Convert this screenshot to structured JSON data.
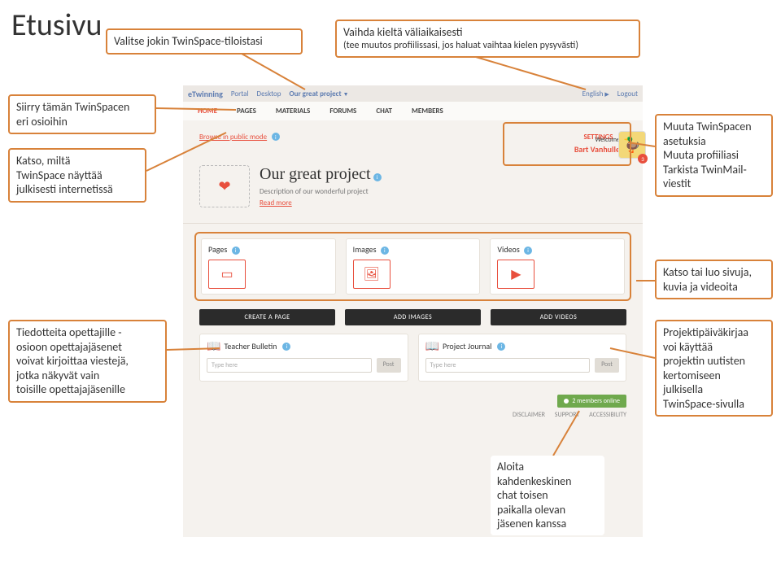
{
  "page_title": "Etusivu",
  "callouts": {
    "c1": "Valitse jokin TwinSpace-tiloistasi",
    "c2_l1": "Vaihda kieltä väliaikaisesti",
    "c2_l2": "(tee muutos profiilissasi, jos haluat vaihtaa kielen pysyvästi)",
    "c3_l1": "Siirry tämän TwinSpacen",
    "c3_l2": "eri osioihin",
    "c4_l1": "Katso, miltä",
    "c4_l2": "TwinSpace näyttää",
    "c4_l3": "julkisesti internetissä",
    "c5_l1": "Muuta TwinSpacen",
    "c5_l2": "asetuksia",
    "c5_l3": "Muuta profiiliasi",
    "c5_l4": "Tarkista TwinMail-",
    "c5_l5": "viestit",
    "c6_l1": "Katso tai luo sivuja,",
    "c6_l2": "kuvia ja videoita",
    "c7_l1": "Tiedotteita opettajille -",
    "c7_l2": "osioon opettajajäsenet",
    "c7_l3": "voivat kirjoittaa viestejä,",
    "c7_l4": "jotka näkyvät vain",
    "c7_l5": "toisille opettajajäsenille",
    "c8_l1": "Projektipäiväkirjaa",
    "c8_l2": "voi käyttää",
    "c8_l3": "projektin uutisten",
    "c8_l4": "kertomiseen",
    "c8_l5": "julkisella",
    "c8_l6": "TwinSpace-sivulla",
    "c9_l1": "Aloita",
    "c9_l2": "kahdenkeskinen",
    "c9_l3": "chat toisen",
    "c9_l4": "paikalla olevan",
    "c9_l5": "jäsenen kanssa"
  },
  "topbar": {
    "logo": "eTwinning",
    "portal": "Portal",
    "desktop": "Desktop",
    "project": "Our great project",
    "english": "English",
    "logout": "Logout"
  },
  "nav": {
    "home": "HOME",
    "pages": "PAGES",
    "materials": "MATERIALS",
    "forums": "FORUMS",
    "chat": "CHAT",
    "members": "MEMBERS"
  },
  "browse": "Browse in public mode",
  "settings": "SETTINGS",
  "welcome": {
    "label": "Welcome",
    "name": "Bart Vanhulle",
    "mail_badge": "3"
  },
  "project": {
    "title": "Our great project",
    "desc": "Description of our wonderful project",
    "readmore": "Read more"
  },
  "cards": {
    "pages": "Pages",
    "images": "Images",
    "videos": "Videos"
  },
  "buttons": {
    "create_page": "CREATE A PAGE",
    "add_images": "ADD IMAGES",
    "add_videos": "ADD VIDEOS"
  },
  "panels": {
    "bulletin": "Teacher Bulletin",
    "journal": "Project Journal",
    "placeholder": "Type here",
    "post": "Post"
  },
  "status": {
    "online": "2 members online"
  },
  "footer": {
    "disclaimer": "DISCLAIMER",
    "support": "SUPPORT",
    "accessibility": "ACCESSIBILITY"
  }
}
